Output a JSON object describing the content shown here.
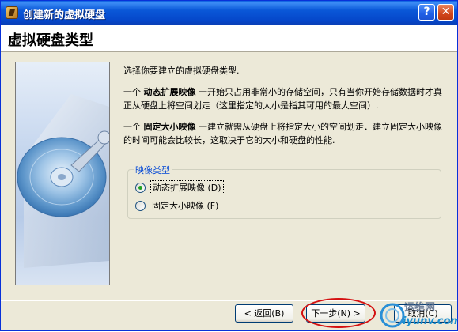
{
  "window": {
    "title": "创建新的虚拟硬盘",
    "help_icon_glyph": "?",
    "close_icon_glyph": "✕"
  },
  "header": {
    "title": "虚拟硬盘类型"
  },
  "content": {
    "intro": "选择你要建立的虚拟硬盘类型.",
    "dynamic_prefix": "一个 ",
    "dynamic_term": "动态扩展映像",
    "dynamic_desc": " 一开始只占用非常小的存储空间，只有当你开始存储数据时才真正从硬盘上将空间划走（这里指定的大小是指其可用的最大空间）.",
    "fixed_prefix": "一个 ",
    "fixed_term": "固定大小映像",
    "fixed_desc": " 一建立就需从硬盘上将指定大小的空间划走．建立固定大小映像的时间可能会比较长，这取决于它的大小和硬盘的性能."
  },
  "image_type": {
    "group_label": "映像类型",
    "options": [
      {
        "label": "动态扩展映像 (D)",
        "checked": true
      },
      {
        "label": "固定大小映像 (F)",
        "checked": false
      }
    ]
  },
  "buttons": {
    "back": "< 返回(B)",
    "next": "下一步(N) >",
    "cancel": "取消(C)"
  },
  "watermark": {
    "text": "运维网",
    "sub": "iyunv.com"
  },
  "colors": {
    "titlebar": "#0a58d8",
    "accent": "#0046d5",
    "highlight": "#d41010"
  }
}
